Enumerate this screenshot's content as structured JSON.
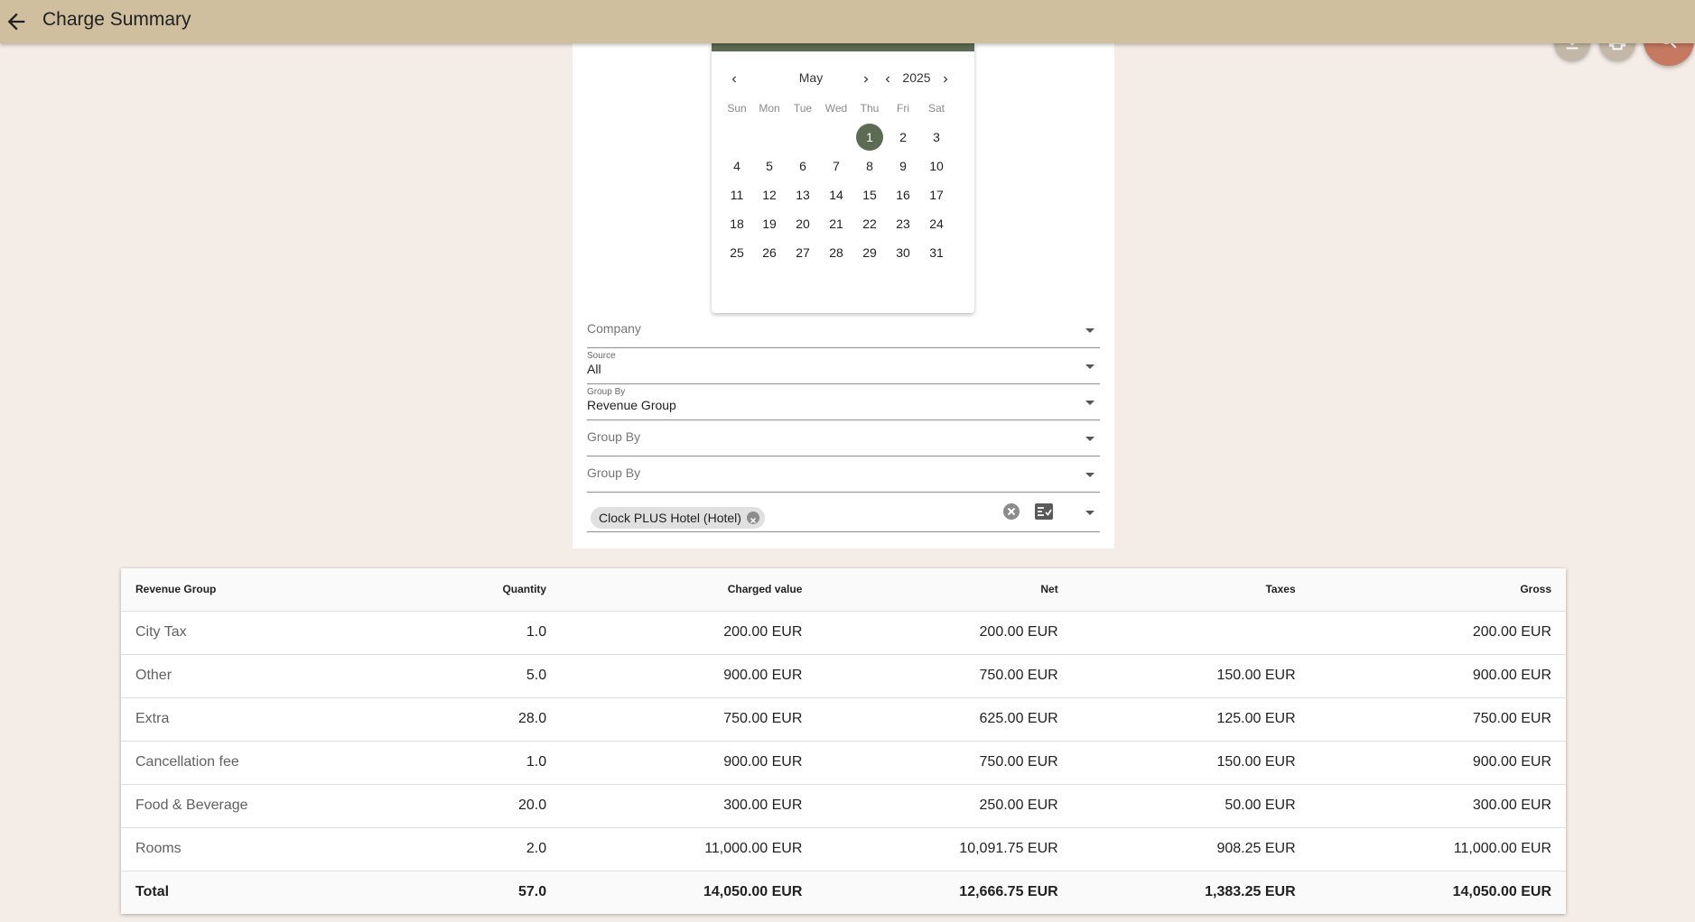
{
  "header": {
    "title": "Charge Summary",
    "icons": {
      "back": "arrow-left-icon",
      "download": "download-icon",
      "print": "print-icon",
      "search": "search-icon"
    },
    "accent": "#cfbf9f",
    "search_fab_color": "#c77860"
  },
  "calendar": {
    "month": "May",
    "year": "2025",
    "weekdays": [
      "Sun",
      "Mon",
      "Tue",
      "Wed",
      "Thu",
      "Fri",
      "Sat"
    ],
    "first_weekday_index": 4,
    "days_in_month": 31,
    "selected_day": 1,
    "selected_color": "#5d6b52"
  },
  "filters": {
    "company": {
      "placeholder": "Company"
    },
    "source": {
      "label": "Source",
      "value": "All"
    },
    "group_by_1": {
      "label": "Group By",
      "value": "Revenue Group"
    },
    "group_by_2": {
      "placeholder": "Group By"
    },
    "group_by_3": {
      "placeholder": "Group By"
    },
    "property": {
      "chip": "Clock PLUS Hotel (Hotel)"
    }
  },
  "table": {
    "columns": [
      "Revenue Group",
      "Quantity",
      "Charged value",
      "Net",
      "Taxes",
      "Gross"
    ],
    "rows": [
      [
        "City Tax",
        "1.0",
        "200.00 EUR",
        "200.00 EUR",
        "",
        "200.00 EUR"
      ],
      [
        "Other",
        "5.0",
        "900.00 EUR",
        "750.00 EUR",
        "150.00 EUR",
        "900.00 EUR"
      ],
      [
        "Extra",
        "28.0",
        "750.00 EUR",
        "625.00 EUR",
        "125.00 EUR",
        "750.00 EUR"
      ],
      [
        "Cancellation fee",
        "1.0",
        "900.00 EUR",
        "750.00 EUR",
        "150.00 EUR",
        "900.00 EUR"
      ],
      [
        "Food & Beverage",
        "20.0",
        "300.00 EUR",
        "250.00 EUR",
        "50.00 EUR",
        "300.00 EUR"
      ],
      [
        "Rooms",
        "2.0",
        "11,000.00 EUR",
        "10,091.75 EUR",
        "908.25 EUR",
        "11,000.00 EUR"
      ]
    ],
    "total": [
      "Total",
      "57.0",
      "14,050.00 EUR",
      "12,666.75 EUR",
      "1,383.25 EUR",
      "14,050.00 EUR"
    ]
  }
}
